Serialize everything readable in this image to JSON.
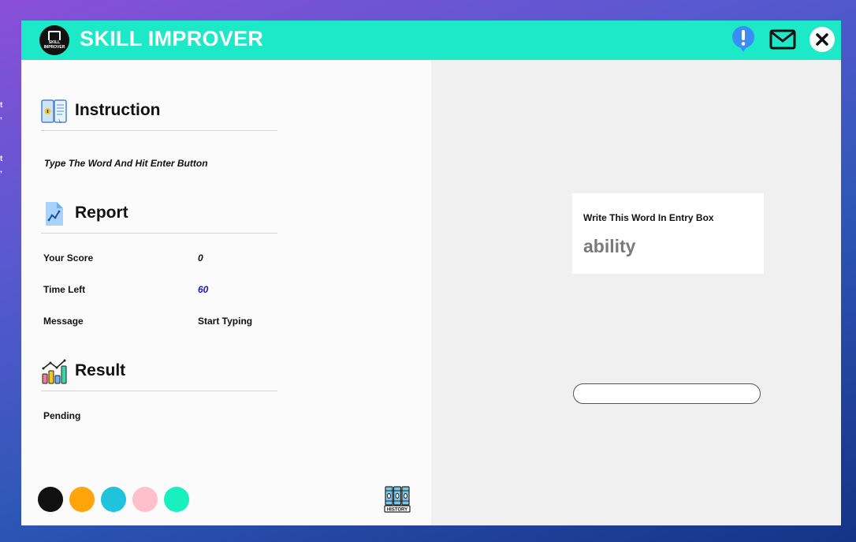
{
  "app": {
    "title": "SKILL IMPROVER",
    "logo_text": "SKILL IMPROVER"
  },
  "titlebar_icons": [
    "info-alert-icon",
    "mail-icon",
    "close-icon"
  ],
  "instruction": {
    "heading": "Instruction",
    "text": "Type The Word And Hit Enter Button"
  },
  "report": {
    "heading": "Report",
    "rows": [
      {
        "label": "Your Score",
        "value": "0"
      },
      {
        "label": "Time Left",
        "value": "60"
      },
      {
        "label": "Message",
        "value": "Start Typing"
      }
    ]
  },
  "result": {
    "heading": "Result",
    "text": "Pending"
  },
  "theme_swatches": [
    "#111111",
    "#ffa40a",
    "#20c3dc",
    "#ffc0cb",
    "#19f0c0"
  ],
  "history": {
    "label": "HISTORY"
  },
  "challenge": {
    "prompt": "Write This Word In Entry Box",
    "word": "ability"
  },
  "entry": {
    "value": ""
  },
  "colors": {
    "titlebar": "#1de9c8",
    "time_left": "#1a1ab5",
    "word": "#7a7a7a"
  }
}
